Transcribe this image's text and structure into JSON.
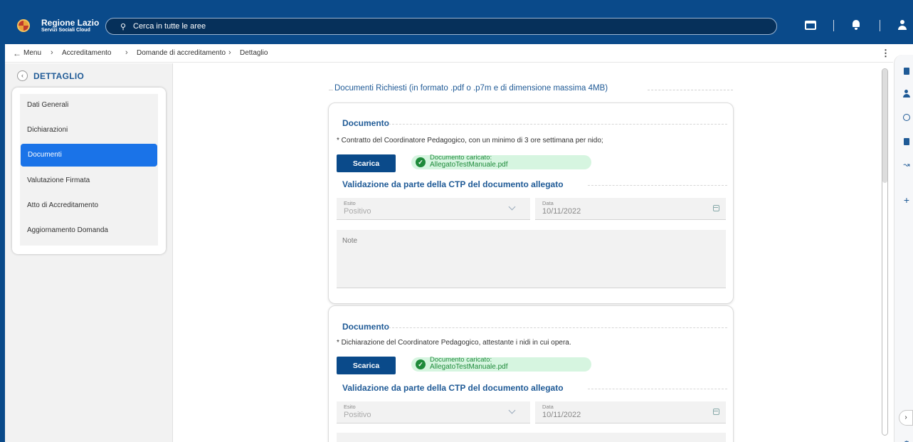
{
  "header": {
    "brand_title": "Regione Lazio",
    "brand_subtitle": "Servizi Sociali Cloud",
    "search_placeholder": "Cerca in tutte le aree",
    "color": "#0a4a8a"
  },
  "breadcrumb": {
    "items": [
      "Menu",
      "Accreditamento",
      "Domande di accreditamento",
      "Dettaglio"
    ],
    "separator": "›"
  },
  "sidebar": {
    "title": "DETTAGLIO",
    "items": [
      {
        "label": "Dati Generali",
        "active": false
      },
      {
        "label": "Dichiarazioni",
        "active": false
      },
      {
        "label": "Documenti",
        "active": true
      },
      {
        "label": "Valutazione Firmata",
        "active": false
      },
      {
        "label": "Atto di Accreditamento",
        "active": false
      },
      {
        "label": "Aggiornamento Domanda",
        "active": false
      }
    ]
  },
  "main": {
    "section_title": "Documenti Richiesti (in formato .pdf o .p7m e di dimensione massima 4MB)",
    "documents": [
      {
        "title": "Documento",
        "description": "* Contratto del Coordinatore Pedagogico, con un minimo di 3 ore settimana per nido;",
        "download_label": "Scarica",
        "status_line1": "Documento caricato:",
        "status_line2": "AllegatoTestManuale.pdf",
        "validation_title": "Validazione da parte della CTP del documento allegato",
        "esito_label": "Esito",
        "esito_value": "Positivo",
        "data_label": "Data",
        "data_value": "10/11/2022",
        "note_label": "Note"
      },
      {
        "title": "Documento",
        "description": "* Dichiarazione del Coordinatore Pedagogico, attestante i nidi in cui opera.",
        "download_label": "Scarica",
        "status_line1": "Documento caricato:",
        "status_line2": "AllegatoTestManuale.pdf",
        "validation_title": "Validazione da parte della CTP del documento allegato",
        "esito_label": "Esito",
        "esito_value": "Positivo",
        "data_label": "Data",
        "data_value": "10/11/2022"
      }
    ]
  },
  "colors": {
    "primary": "#0a4a8a",
    "accent": "#1a73e8",
    "success": "#1e8a3a",
    "success_bg": "#d6f5e0",
    "heading": "#1f5a96"
  },
  "icons": {
    "brand": "regione-lazio-logo",
    "search": "search-icon",
    "window": "window-icon",
    "notifications": "bell-icon",
    "user": "user-icon",
    "rail": [
      "calculator-icon",
      "people-icon",
      "history-icon",
      "book-icon",
      "trend-icon",
      "plus-icon",
      "accessibility-icon",
      "gear-icon"
    ]
  }
}
